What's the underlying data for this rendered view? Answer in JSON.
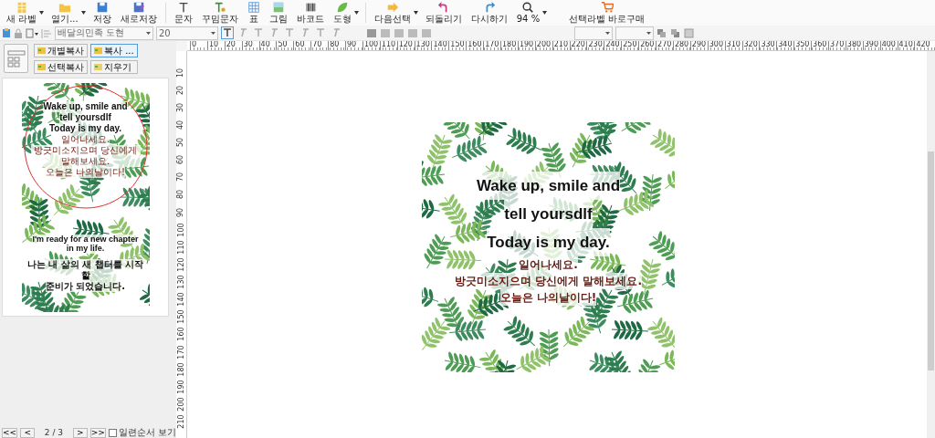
{
  "toolbar": [
    {
      "label": "새 라벨",
      "has_menu": true
    },
    {
      "label": "열기...",
      "has_menu": true
    },
    {
      "label": "저장",
      "has_menu": false
    },
    {
      "label": "새로저장",
      "has_menu": false
    },
    {
      "label": "문자",
      "has_menu": false
    },
    {
      "label": "꾸밈문자",
      "has_menu": false
    },
    {
      "label": "표",
      "has_menu": false
    },
    {
      "label": "그림",
      "has_menu": false
    },
    {
      "label": "바코드",
      "has_menu": false
    },
    {
      "label": "도형",
      "has_menu": true
    },
    {
      "label": "다음선택",
      "has_menu": true
    },
    {
      "label": "되돌리기",
      "has_menu": false
    },
    {
      "label": "다시하기",
      "has_menu": false
    },
    {
      "label": "94 %",
      "has_menu": true
    },
    {
      "label": "선택라벨 바로구매",
      "has_menu": false
    }
  ],
  "format_bar": {
    "font": "배달의민족 도현",
    "size": "20",
    "text_tools": [
      {
        "selected": true
      },
      {
        "selected": false
      },
      {
        "selected": false
      },
      {
        "selected": false
      },
      {
        "selected": false
      },
      {
        "selected": false
      },
      {
        "selected": false
      },
      {
        "selected": false
      }
    ]
  },
  "ruler": {
    "horizontal": [
      "0",
      "10",
      "20",
      "30",
      "40",
      "50",
      "60",
      "70",
      "80",
      "90",
      "100",
      "110",
      "120",
      "130",
      "140",
      "150",
      "160",
      "170",
      "180",
      "190",
      "200",
      "210",
      "220",
      "230",
      "240",
      "250",
      "260",
      "270",
      "280",
      "290",
      "300",
      "310",
      "320",
      "330",
      "340",
      "350",
      "360",
      "370",
      "380",
      "390",
      "400",
      "410",
      "420"
    ],
    "vertical": [
      "10",
      "20",
      "30",
      "40",
      "50",
      "60",
      "70",
      "80",
      "90",
      "100",
      "110",
      "120",
      "130",
      "140",
      "150",
      "160",
      "170",
      "180",
      "190",
      "200",
      "210"
    ]
  },
  "copy_buttons": [
    {
      "label": "개별복사",
      "selected": false
    },
    {
      "label": "복사 ...",
      "selected": true
    },
    {
      "label": "선택복사",
      "selected": false
    },
    {
      "label": "지우기",
      "selected": false
    }
  ],
  "thumbnail": {
    "english_lines": [
      "Wake up, smile and",
      "tell yoursdlf",
      "Today is my day."
    ],
    "korean_lines": [
      "일어나세요.",
      "방긋미소지으며 당신에게 말해보세요.",
      "오늘은 나의날이다!"
    ],
    "lower_lines": [
      "I'm ready for a new chapter",
      "in my life."
    ],
    "lower_korean_lines": [
      "나는 내 삶의 새 챕터를 시작할",
      "준비가 되었습니다."
    ]
  },
  "pager": {
    "first": "<<",
    "prev": "<",
    "page": "2 / 3",
    "next": ">",
    "last": ">>",
    "option": {
      "label": "일련순서 보기",
      "checked": false
    }
  },
  "label": {
    "english_lines": [
      "Wake up, smile and",
      "tell yoursdlf",
      "Today is my day."
    ],
    "korean_lines": [
      "일어나세요.",
      "방긋미소지으며 당신에게 말해보세요.",
      "오늘은 나의날이다!"
    ]
  }
}
